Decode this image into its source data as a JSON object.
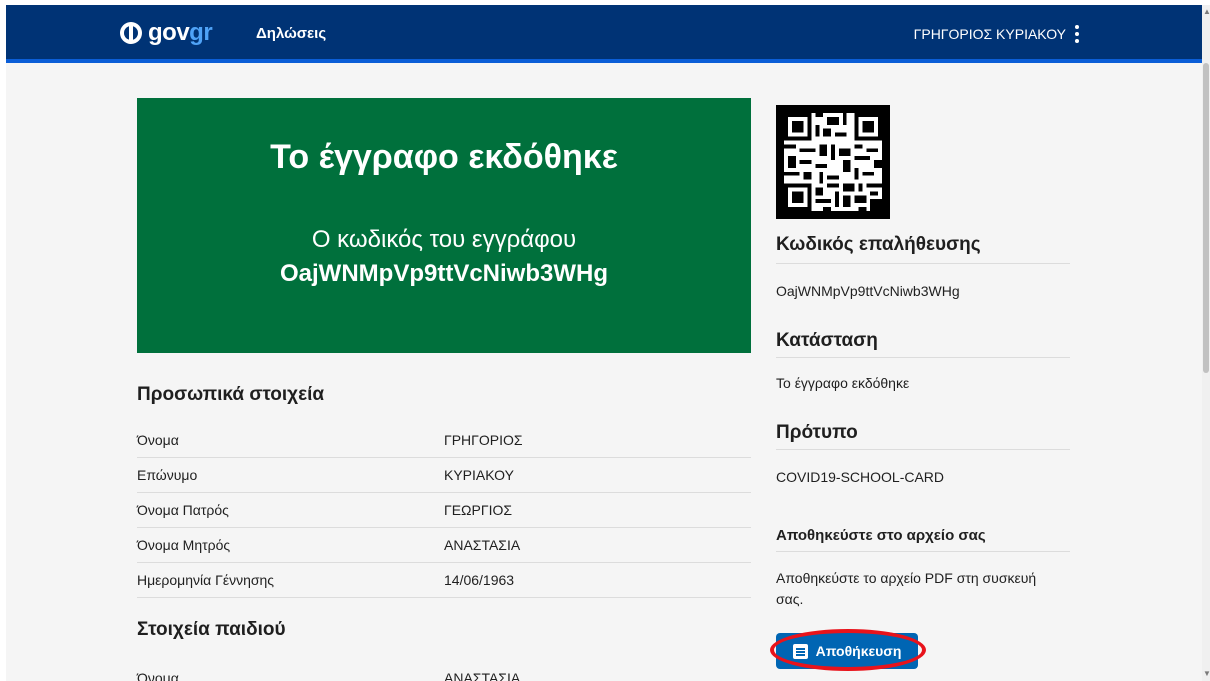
{
  "header": {
    "logo_gov": "gov",
    "logo_gr": "gr",
    "nav_label": "Δηλώσεις",
    "user_name": "ΓΡΗΓΟΡΙΟΣ ΚΥΡΙΑΚΟΥ",
    "menu_icon": "more-vert-icon"
  },
  "banner": {
    "title": "Το έγγραφο εκδόθηκε",
    "subtitle": "Ο κωδικός του εγγράφου",
    "code": "OajWNMpVp9ttVcNiwb3WHg"
  },
  "personal": {
    "title": "Προσωπικά στοιχεία",
    "rows": [
      {
        "label": "Όνομα",
        "value": "ΓΡΗΓΟΡΙΟΣ"
      },
      {
        "label": "Επώνυμο",
        "value": "ΚΥΡΙΑΚΟΥ"
      },
      {
        "label": "Όνομα Πατρός",
        "value": "ΓΕΩΡΓΙΟΣ"
      },
      {
        "label": "Όνομα Μητρός",
        "value": "ΑΝΑΣΤΑΣΙΑ"
      },
      {
        "label": "Ημερομηνία Γέννησης",
        "value": "14/06/1963"
      }
    ]
  },
  "child": {
    "title": "Στοιχεία παιδιού",
    "rows": [
      {
        "label": "Όνομα",
        "value": "ΑΝΑΣΤΑΣΙΑ"
      }
    ]
  },
  "sidebar": {
    "qr_icon": "qr-code-icon",
    "verification_title": "Κωδικός επαλήθευσης",
    "verification_code": "OajWNMpVp9ttVcNiwb3WHg",
    "status_title": "Κατάσταση",
    "status_value": "Το έγγραφο εκδόθηκε",
    "template_title": "Πρότυπο",
    "template_value": "COVID19-SCHOOL-CARD",
    "save_title": "Αποθηκεύστε στο αρχείο σας",
    "save_text": "Αποθηκεύστε το αρχείο PDF στη συσκευή σας.",
    "save_button": "Αποθήκευση",
    "save_button_icon": "pdf-icon"
  },
  "colors": {
    "header_bg": "#003375",
    "banner_bg": "#00703c",
    "button_bg": "#0065b3",
    "highlight": "#e8131b"
  },
  "scrollbar": {
    "up_arrow": "▲",
    "down_arrow": "▼"
  }
}
